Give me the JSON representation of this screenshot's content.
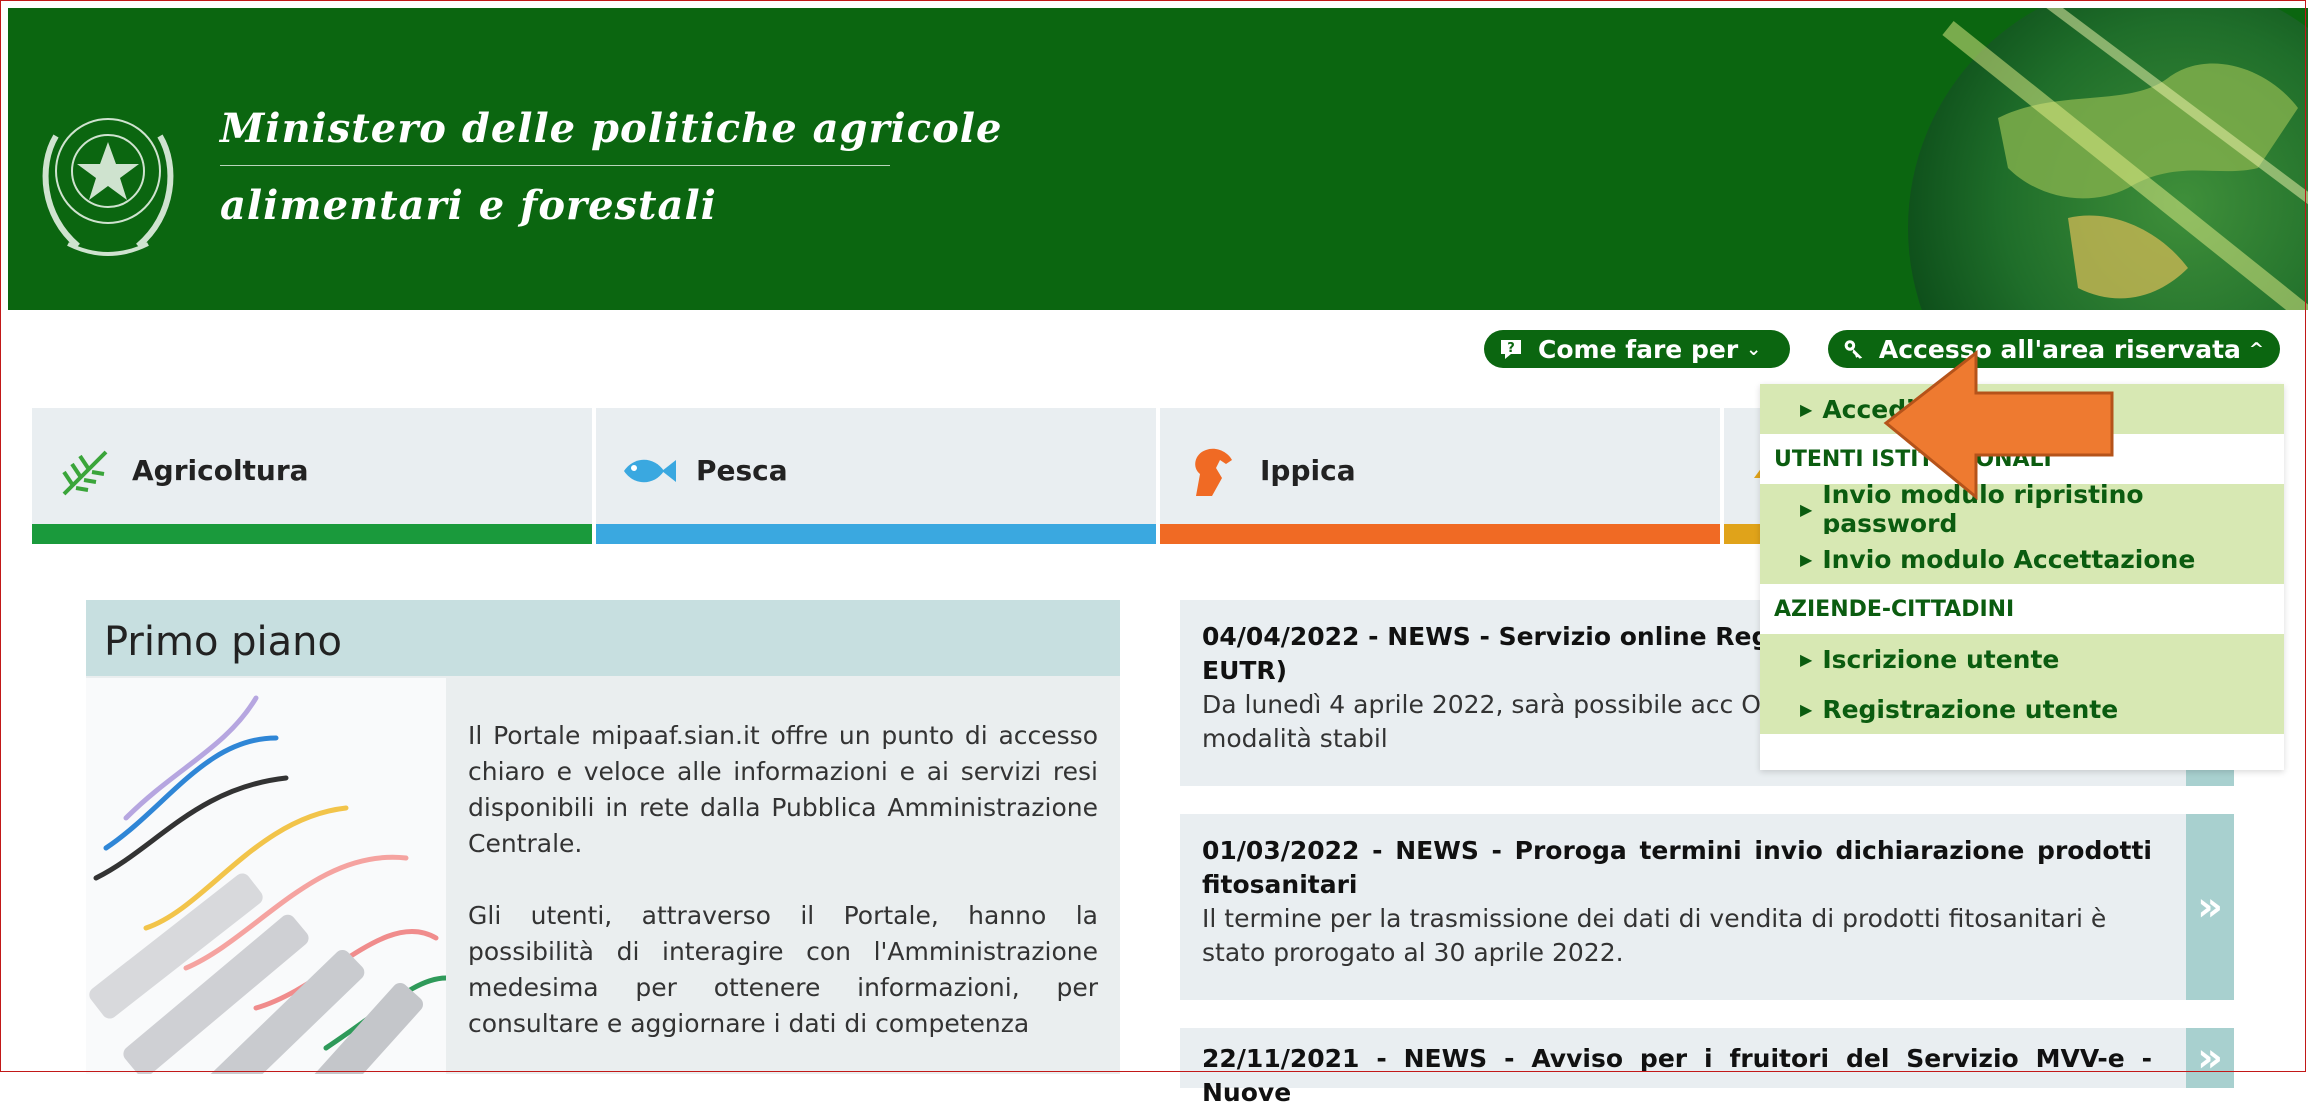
{
  "header": {
    "ministry_line1": "Ministero delle politiche agricole",
    "ministry_line2": "alimentari e forestali",
    "colors": {
      "header_bg": "#0b6610",
      "accent_green": "#0b5c10"
    }
  },
  "top_buttons": {
    "come_fare": {
      "label": "Come fare per",
      "icon": "help-icon",
      "chevron": "⌄"
    },
    "accesso": {
      "label": "Accesso all'area riservata",
      "icon": "key-icon",
      "chevron": "^"
    }
  },
  "sectors": [
    {
      "label": "Agricoltura",
      "icon": "wheat-icon",
      "color": "#1a9a3c"
    },
    {
      "label": "Pesca",
      "icon": "fish-icon",
      "color": "#3aa8e0"
    },
    {
      "label": "Ippica",
      "icon": "horse-icon",
      "color": "#f06a24"
    },
    {
      "label": "",
      "icon": "forest-icon",
      "color": "#e0a31a"
    }
  ],
  "primo_piano": {
    "title": "Primo piano",
    "paragraph1": "Il Portale mipaaf.sian.it offre un punto di accesso chiaro e veloce alle informazioni e ai servizi resi disponibili in rete dalla Pubblica Amministrazione Centrale.",
    "paragraph2": "Gli utenti, attraverso il Portale, hanno la possibilità di interagire con l'Amministrazione medesima per ottenere informazioni, per consultare e aggiornare i dati di competenza"
  },
  "news": [
    {
      "title": "04/04/2022 - NEWS - Servizio online Regis",
      "title_cont": "EUTR)",
      "text": "Da lunedì 4 aprile 2022, sarà possibile acc Operatori EUTR secondo le modalità stabil",
      "arrow": "»"
    },
    {
      "title": "01/03/2022 - NEWS - Proroga termini invio dichiarazione prodotti fitosanitari",
      "text": "Il termine per la trasmissione dei dati di vendita di prodotti fitosanitari è stato prorogato al 30 aprile 2022.",
      "arrow": "»"
    },
    {
      "title": "22/11/2021 - NEWS - Avviso per i fruitori del Servizio MVV-e - Nuove",
      "arrow": "»"
    }
  ],
  "dropdown": {
    "accedi": "Accedi",
    "section_istituzionali": "UTENTI ISTITUZIONALI",
    "ripristino": "Invio modulo ripristino password",
    "accettazione": "Invio modulo Accettazione",
    "section_aziende": "AZIENDE-CITTADINI",
    "iscrizione": "Iscrizione utente",
    "registrazione": "Registrazione utente"
  }
}
